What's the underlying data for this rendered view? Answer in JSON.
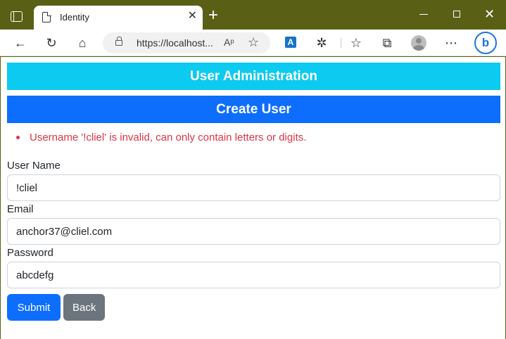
{
  "browser": {
    "tab_title": "Identity",
    "tab_close": "✕",
    "new_tab": "+",
    "url": "https://localhost...",
    "window_close": "✕",
    "read_aloud": "Aᵖ",
    "ext_label": "A",
    "bing_label": "b"
  },
  "icons": {
    "back": "←",
    "refresh": "↻",
    "home": "⌂",
    "favorite_add": "☆",
    "extensions": "✲",
    "favorites": "☆",
    "collections": "⧉",
    "more": "⋯"
  },
  "page": {
    "admin_title": "User Administration",
    "create_title": "Create User",
    "errors": [
      "Username '!cliel' is invalid, can only contain letters or digits."
    ],
    "form": {
      "username_label": "User Name",
      "username_value": "!cliel",
      "email_label": "Email",
      "email_value": "anchor37@cliel.com",
      "password_label": "Password",
      "password_value": "abcdefg"
    },
    "buttons": {
      "submit": "Submit",
      "back": "Back"
    }
  },
  "colors": {
    "admin_banner": "#0dcaf0",
    "create_banner": "#0d6efd",
    "error_text": "#dc3545",
    "back_button": "#6c757d",
    "chrome": "#5a5f16"
  }
}
